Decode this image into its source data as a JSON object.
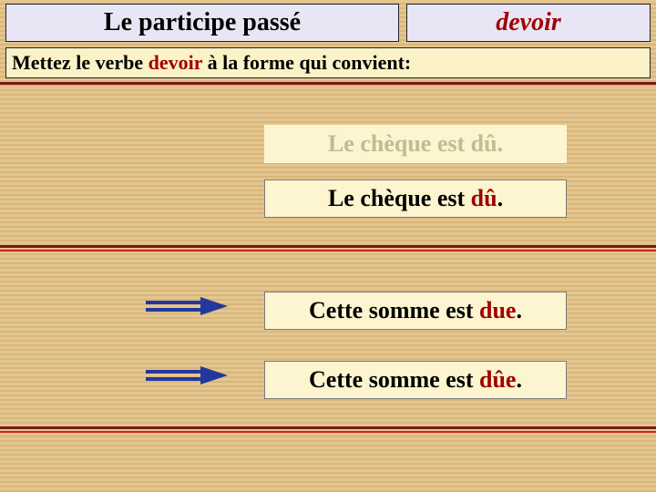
{
  "header": {
    "left": "Le participe passé",
    "right": "devoir"
  },
  "instruction": {
    "pre": "Mettez le verbe ",
    "kw": "devoir",
    "post": " à la forme qui convient:"
  },
  "block1": {
    "opt_a": {
      "pre": "Le chèque est ",
      "hl": "dû",
      "post": "."
    },
    "opt_b": {
      "pre": "Le chèque est ",
      "hl": "dû",
      "post": "."
    }
  },
  "block2": {
    "opt_a": {
      "pre": "Cette somme est ",
      "hl": "due",
      "post": "."
    },
    "opt_b": {
      "pre": "Cette somme est ",
      "hl": "dûe",
      "post": "."
    }
  },
  "colors": {
    "accent": "#a00000",
    "box_bg": "#fcf5cf",
    "header_bg": "#e8e6f5"
  }
}
